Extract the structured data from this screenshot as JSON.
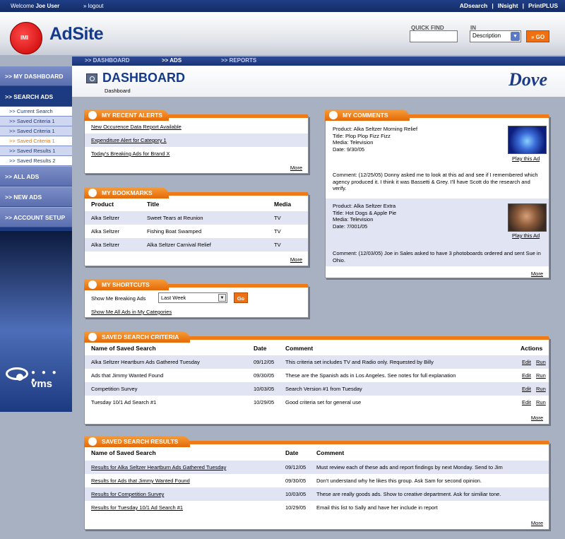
{
  "topbar": {
    "welcome": "Welcome",
    "user": "Joe User",
    "logout": "logout",
    "products": [
      "ADsearch",
      "INsight",
      "PrintPLUS"
    ]
  },
  "header": {
    "logo_badge": "IMI",
    "site_name": "AdSite",
    "quick_find_label": "QUICK FIND",
    "in_label": "IN",
    "in_selected": "Description",
    "go": "GO"
  },
  "topnav": {
    "tabs": [
      ">> DASHBOARD",
      ">> ADS",
      ">> REPORTS"
    ]
  },
  "sidebar": {
    "main": [
      ">> MY DASHBOARD",
      ">> SEARCH ADS"
    ],
    "sub": [
      ">> Current Search",
      ">> Saved Criteria 1",
      ">> Saved Criteria 1",
      ">> Saved Criteria 1",
      ">> Saved Results 1",
      ">> Saved Results 2"
    ],
    "main2": [
      ">> ALL ADS",
      ">> NEW ADS",
      ">> ACCOUNT SETUP"
    ],
    "brand_text": "vms",
    "brand_dots": "● ● ● ●"
  },
  "page": {
    "title": "DASHBOARD",
    "breadcrumb": "Dashboard",
    "brand": "Dove"
  },
  "alerts": {
    "title": "MY RECENT ALERTS",
    "items": [
      "New Occurence Data Report Available",
      "Expenditure Alert for Category 1",
      "Today's Breaking Ads for Brand X"
    ],
    "more": "More"
  },
  "bookmarks": {
    "title": "MY BOOKMARKS",
    "headers": [
      "Product",
      "Title",
      "Media"
    ],
    "rows": [
      [
        "Alka Seltzer",
        "Sweet Tears at Reunion",
        "TV"
      ],
      [
        "Alka Seltzer",
        "Fishing Boat Swamped",
        "TV"
      ],
      [
        "Alka Seltzer",
        "Alka Seltzer Carnival Relief",
        "TV"
      ]
    ],
    "more": "More"
  },
  "shortcuts": {
    "title": "MY SHORTCUTS",
    "label": "Show Me Breaking Ads",
    "selected": "Last Week",
    "go": "Go",
    "link": "Show Me All Ads in My Categories"
  },
  "comments": {
    "title": "MY COMMENTS",
    "items": [
      {
        "product": "Product: Alka Seltzer Morning Relief",
        "title": "Title: Plop Plop Fizz Fizz",
        "media": "Media: Television",
        "date": "Date: 9/30/05",
        "play": "Play this Ad",
        "comment": "Comment: (12/25/05) Donny asked me to look at this ad and see if I remembered which agency produced it. I think it was Bassetti & Grey. I'll have Scott do the research and verify."
      },
      {
        "product": "Product: Alka Seltzer Extra",
        "title": "Title: Hot Dogs & Apple Pie",
        "media": "Media: Television",
        "date": "Date: 7/001/05",
        "play": "Play this Ad",
        "comment": "Comment: (12/03/05) Joe in Sales asked to have 3 photoboards ordered and sent Sue in Ohio."
      }
    ],
    "more": "More"
  },
  "criteria": {
    "title": "SAVED SEARCH CRITERIA",
    "headers": [
      "Name of Saved Search",
      "Date",
      "Comment",
      "Actions"
    ],
    "rows": [
      [
        "Alka Seltzer Heartburn Ads Gathered Tuesday",
        "09/12/05",
        "This criteria set includes TV and Radio only. Requested by Billy"
      ],
      [
        "Ads that Jimmy Wanted Found",
        "09/30/05",
        "These are the Spanish ads in Los Angeles. See notes for full explanation"
      ],
      [
        "Competition Survey",
        "10/03/05",
        "Search Version #1 from Tuesday"
      ],
      [
        "Tuesday 10/1 Ad Search #1",
        "10/29/05",
        "Good criteria set for general use"
      ]
    ],
    "edit": "Edit",
    "run": "Run",
    "more": "More"
  },
  "results": {
    "title": "SAVED SEARCH RESULTS",
    "headers": [
      "Name of Saved Search",
      "Date",
      "Comment"
    ],
    "rows": [
      [
        "Results for Alka Seltzer Heartburn Ads Gathered Tuesday",
        "09/12/05",
        "Must review each of these ads and report findings by next Monday. Send to Jim"
      ],
      [
        "Results for Ads that Jimmy Wanted Found",
        "09/30/05",
        "Don't understand why he likes this group. Ask Sam for second opinion."
      ],
      [
        "Results for Competition Survey",
        "10/03/05",
        "These are really goods ads. Show to creative department. Ask for similiar tone."
      ],
      [
        "Results for Tuesday 10/1 Ad Search #1",
        "10/29/05",
        "Email this list to Sally and have her include in report"
      ]
    ],
    "more": "More"
  },
  "colors": {
    "navy": "#1c3a80",
    "orange": "#ef7a18",
    "row_alt": "#e1e4f3"
  }
}
